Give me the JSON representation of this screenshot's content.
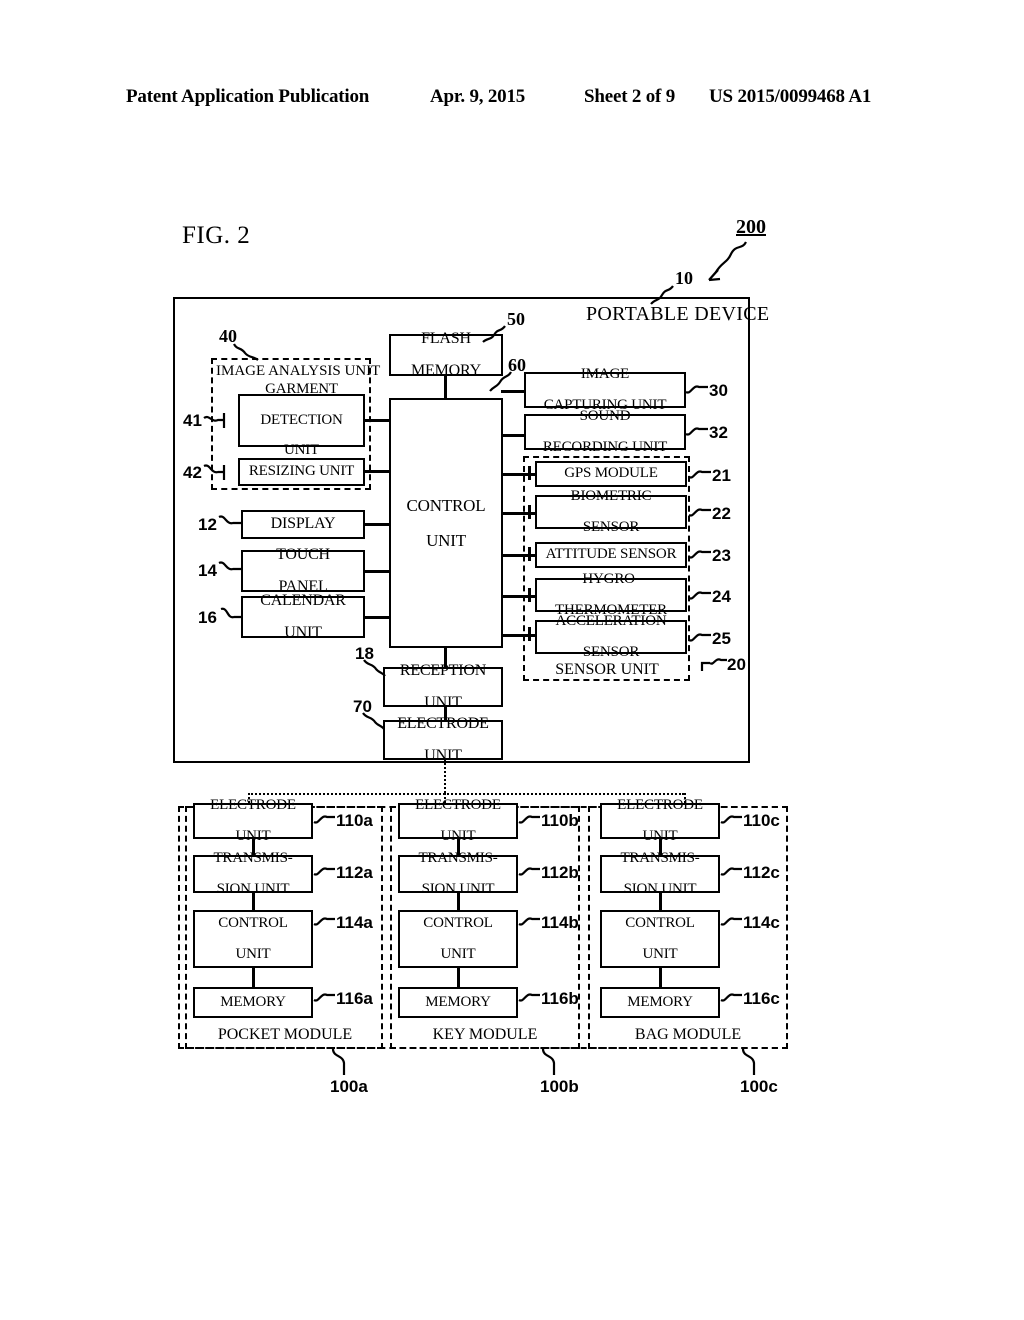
{
  "header": {
    "left": "Patent Application Publication",
    "date": "Apr. 9, 2015",
    "sheet": "Sheet 2 of 9",
    "docnum": "US 2015/0099468 A1"
  },
  "figure": {
    "title": "FIG. 2",
    "system_ref": "200"
  },
  "portable_device": {
    "title": "PORTABLE DEVICE",
    "ref": "10",
    "image_analysis": {
      "label": "IMAGE ANALYSIS UNIT",
      "line1": "IMAGE ANALYSIS",
      "line2": "UNIT",
      "ref": "40",
      "children": [
        {
          "label": "GARMENT DETECTION UNIT",
          "line1": "GARMENT",
          "line2": "DETECTION",
          "line3": "UNIT",
          "ref": "41"
        },
        {
          "label": "RESIZING UNIT",
          "line1": "RESIZING UNIT",
          "ref": "42"
        }
      ]
    },
    "left_blocks": [
      {
        "label": "DISPLAY",
        "line1": "DISPLAY",
        "ref": "12"
      },
      {
        "label": "TOUCH PANEL",
        "line1": "TOUCH",
        "line2": "PANEL",
        "ref": "14"
      },
      {
        "label": "CALENDAR UNIT",
        "line1": "CALENDAR",
        "line2": "UNIT",
        "ref": "16"
      }
    ],
    "flash_memory": {
      "line1": "FLASH",
      "line2": "MEMORY",
      "ref": "50"
    },
    "control_unit": {
      "line1": "CONTROL",
      "line2": "UNIT",
      "ref": "60"
    },
    "right_blocks": [
      {
        "label": "IMAGE CAPTURING UNIT",
        "line1": "IMAGE",
        "line2": "CAPTURING UNIT",
        "ref": "30"
      },
      {
        "label": "SOUND RECORDING UNIT",
        "line1": "SOUND",
        "line2": "RECORDING UNIT",
        "ref": "32"
      }
    ],
    "sensor_unit": {
      "label": "SENSOR UNIT",
      "ref": "20",
      "sensors": [
        {
          "label": "GPS MODULE",
          "line1": "GPS MODULE",
          "ref": "21"
        },
        {
          "label": "BIOMETRIC SENSOR",
          "line1": "BIOMETRIC",
          "line2": "SENSOR",
          "ref": "22"
        },
        {
          "label": "ATTITUDE SENSOR",
          "line1": "ATTITUDE SENSOR",
          "ref": "23"
        },
        {
          "label": "HYGRO-THERMOMETER",
          "line1": "HYGRO-",
          "line2": "THERMOMETER",
          "ref": "24"
        },
        {
          "label": "ACCELERATION SENSOR",
          "line1": "ACCELERATION",
          "line2": "SENSOR",
          "ref": "25"
        }
      ]
    },
    "reception_unit": {
      "line1": "RECEPTION",
      "line2": "UNIT",
      "ref": "18"
    },
    "electrode_unit": {
      "line1": "ELECTRODE",
      "line2": "UNIT",
      "ref": "70"
    }
  },
  "modules": [
    {
      "name": "POCKET MODULE",
      "ref": "100a",
      "blocks": [
        {
          "line1": "ELECTRODE",
          "line2": "UNIT",
          "ref": "110a"
        },
        {
          "line1": "TRANSMIS-",
          "line2": "SION UNIT",
          "ref": "112a"
        },
        {
          "line1": "CONTROL",
          "line2": "UNIT",
          "ref": "114a"
        },
        {
          "line1": "MEMORY",
          "ref": "116a"
        }
      ]
    },
    {
      "name": "KEY MODULE",
      "ref": "100b",
      "blocks": [
        {
          "line1": "ELECTRODE",
          "line2": "UNIT",
          "ref": "110b"
        },
        {
          "line1": "TRANSMIS-",
          "line2": "SION UNIT",
          "ref": "112b"
        },
        {
          "line1": "CONTROL",
          "line2": "UNIT",
          "ref": "114b"
        },
        {
          "line1": "MEMORY",
          "ref": "116b"
        }
      ]
    },
    {
      "name": "BAG MODULE",
      "ref": "100c",
      "blocks": [
        {
          "line1": "ELECTRODE",
          "line2": "UNIT",
          "ref": "110c"
        },
        {
          "line1": "TRANSMIS-",
          "line2": "SION UNIT",
          "ref": "112c"
        },
        {
          "line1": "CONTROL",
          "line2": "UNIT",
          "ref": "114c"
        },
        {
          "line1": "MEMORY",
          "ref": "116c"
        }
      ]
    }
  ]
}
